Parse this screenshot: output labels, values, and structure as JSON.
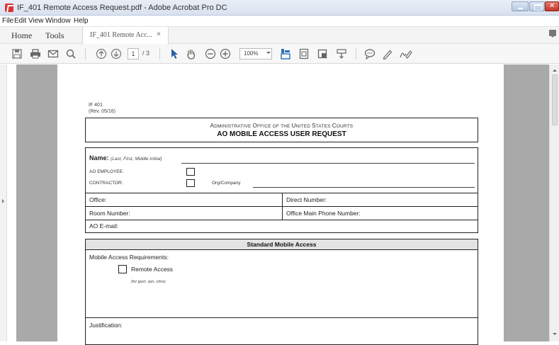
{
  "window": {
    "title": "IF_401 Remote Access Request.pdf - Adobe Acrobat Pro DC"
  },
  "menu": [
    "File",
    "Edit",
    "View",
    "Window",
    "Help"
  ],
  "tabs": {
    "home": "Home",
    "tools": "Tools",
    "document_tab": "IF_401 Remote Acc...",
    "document_tab_close": "×"
  },
  "toolbar": {
    "page_current": "1",
    "page_total": "/ 3",
    "zoom": "100%",
    "icons": [
      "save-icon",
      "print-icon",
      "email-icon",
      "search-icon",
      "prev-page-icon",
      "next-page-icon",
      "select-cursor-icon",
      "hand-tool-icon",
      "zoom-out-icon",
      "zoom-in-icon",
      "fit-width-icon",
      "fit-page-icon",
      "full-screen-icon",
      "keyboard-scroll-icon",
      "comment-icon",
      "highlight-pen-icon",
      "sign-icon"
    ]
  },
  "form": {
    "form_id": "IF 401",
    "revision": "(Rev. 05/16)",
    "office_name_parts": [
      "A",
      "DMINISTRATIVE ",
      "O",
      "FFICE OF THE ",
      "U",
      "NITED ",
      "S",
      "TATES ",
      "C",
      "OURTS"
    ],
    "title": "AO MOBILE ACCESS USER REQUEST",
    "name_label": "Name:",
    "name_hint": "(Last, First, Middle Initial)",
    "ao_employee_label": "AO EMPLOYEE:",
    "contractor_label": "CONTRACTOR:",
    "org_company_label": "Org/Company",
    "office_label": "Office:",
    "direct_number_label": "Direct Number:",
    "room_number_label": "Room Number:",
    "office_main_phone_label": "Office Main Phone Number:",
    "ao_email_label": "AO E-mail:",
    "section_title": "Standard Mobile Access",
    "mobile_requirements_label": "Mobile Access Requirements:",
    "remote_access_label": "Remote Access",
    "remote_access_hint": "(for jport, vpn, citrix)",
    "justification_label": "Justification:"
  }
}
